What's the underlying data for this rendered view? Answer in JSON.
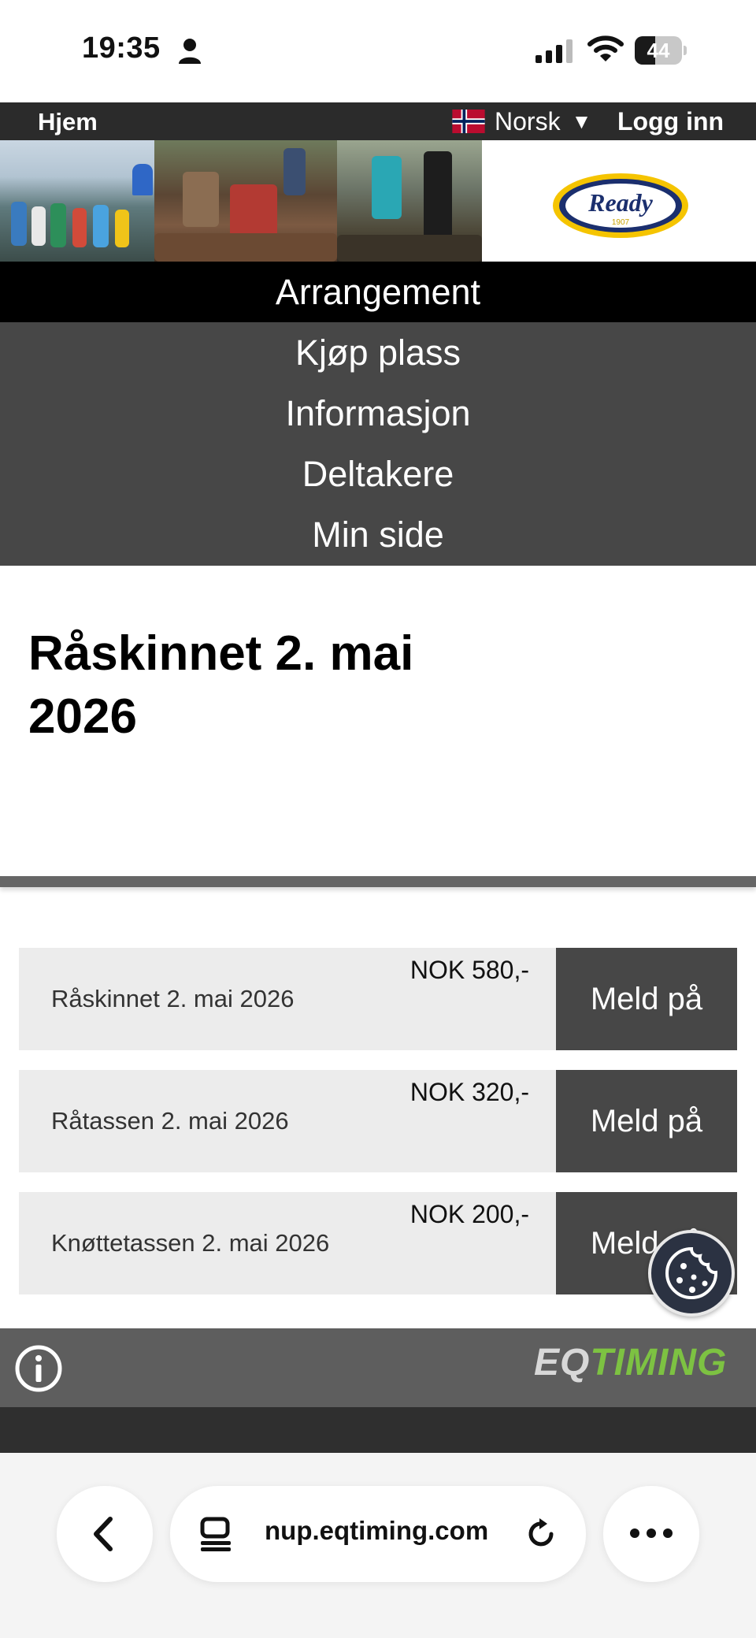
{
  "status_bar": {
    "time": "19:35",
    "battery_level": "44",
    "battery_fraction": 0.44
  },
  "top_nav": {
    "home": "Hjem",
    "language": "Norsk",
    "language_caret": "▼",
    "login": "Logg inn"
  },
  "banner": {
    "logo_text": "Ready",
    "logo_year": "1907"
  },
  "menu": {
    "items": [
      {
        "label": "Arrangement",
        "active": true
      },
      {
        "label": "Kjøp plass",
        "active": false
      },
      {
        "label": "Informasjon",
        "active": false
      },
      {
        "label": "Deltakere",
        "active": false
      },
      {
        "label": "Min side",
        "active": false
      }
    ]
  },
  "page": {
    "title": "Råskinnet 2. mai 2026"
  },
  "races": [
    {
      "name": "Råskinnet 2. mai 2026",
      "price": "NOK 580,-",
      "button": "Meld på"
    },
    {
      "name": "Råtassen 2. mai 2026",
      "price": "NOK 320,-",
      "button": "Meld på"
    },
    {
      "name": "Knøttetassen 2. mai 2026",
      "price": "NOK 200,-",
      "button": "Meld på"
    }
  ],
  "footer": {
    "logo_eq": "EQ",
    "logo_timing": "TIMING"
  },
  "browser": {
    "url": "nup.eqtiming.com"
  },
  "colors": {
    "menu_bg": "#474747",
    "menu_active_bg": "#000000",
    "row_bg": "#ececec",
    "button_bg": "#474747",
    "footer_bg": "#5e5e5e",
    "timing_green": "#7dc242"
  },
  "icons": [
    "person-icon",
    "signal-icon",
    "wifi-icon",
    "norway-flag-icon",
    "info-icon",
    "cookie-icon",
    "chevron-left-icon",
    "tabs-icon",
    "reload-icon",
    "more-dots-icon"
  ]
}
